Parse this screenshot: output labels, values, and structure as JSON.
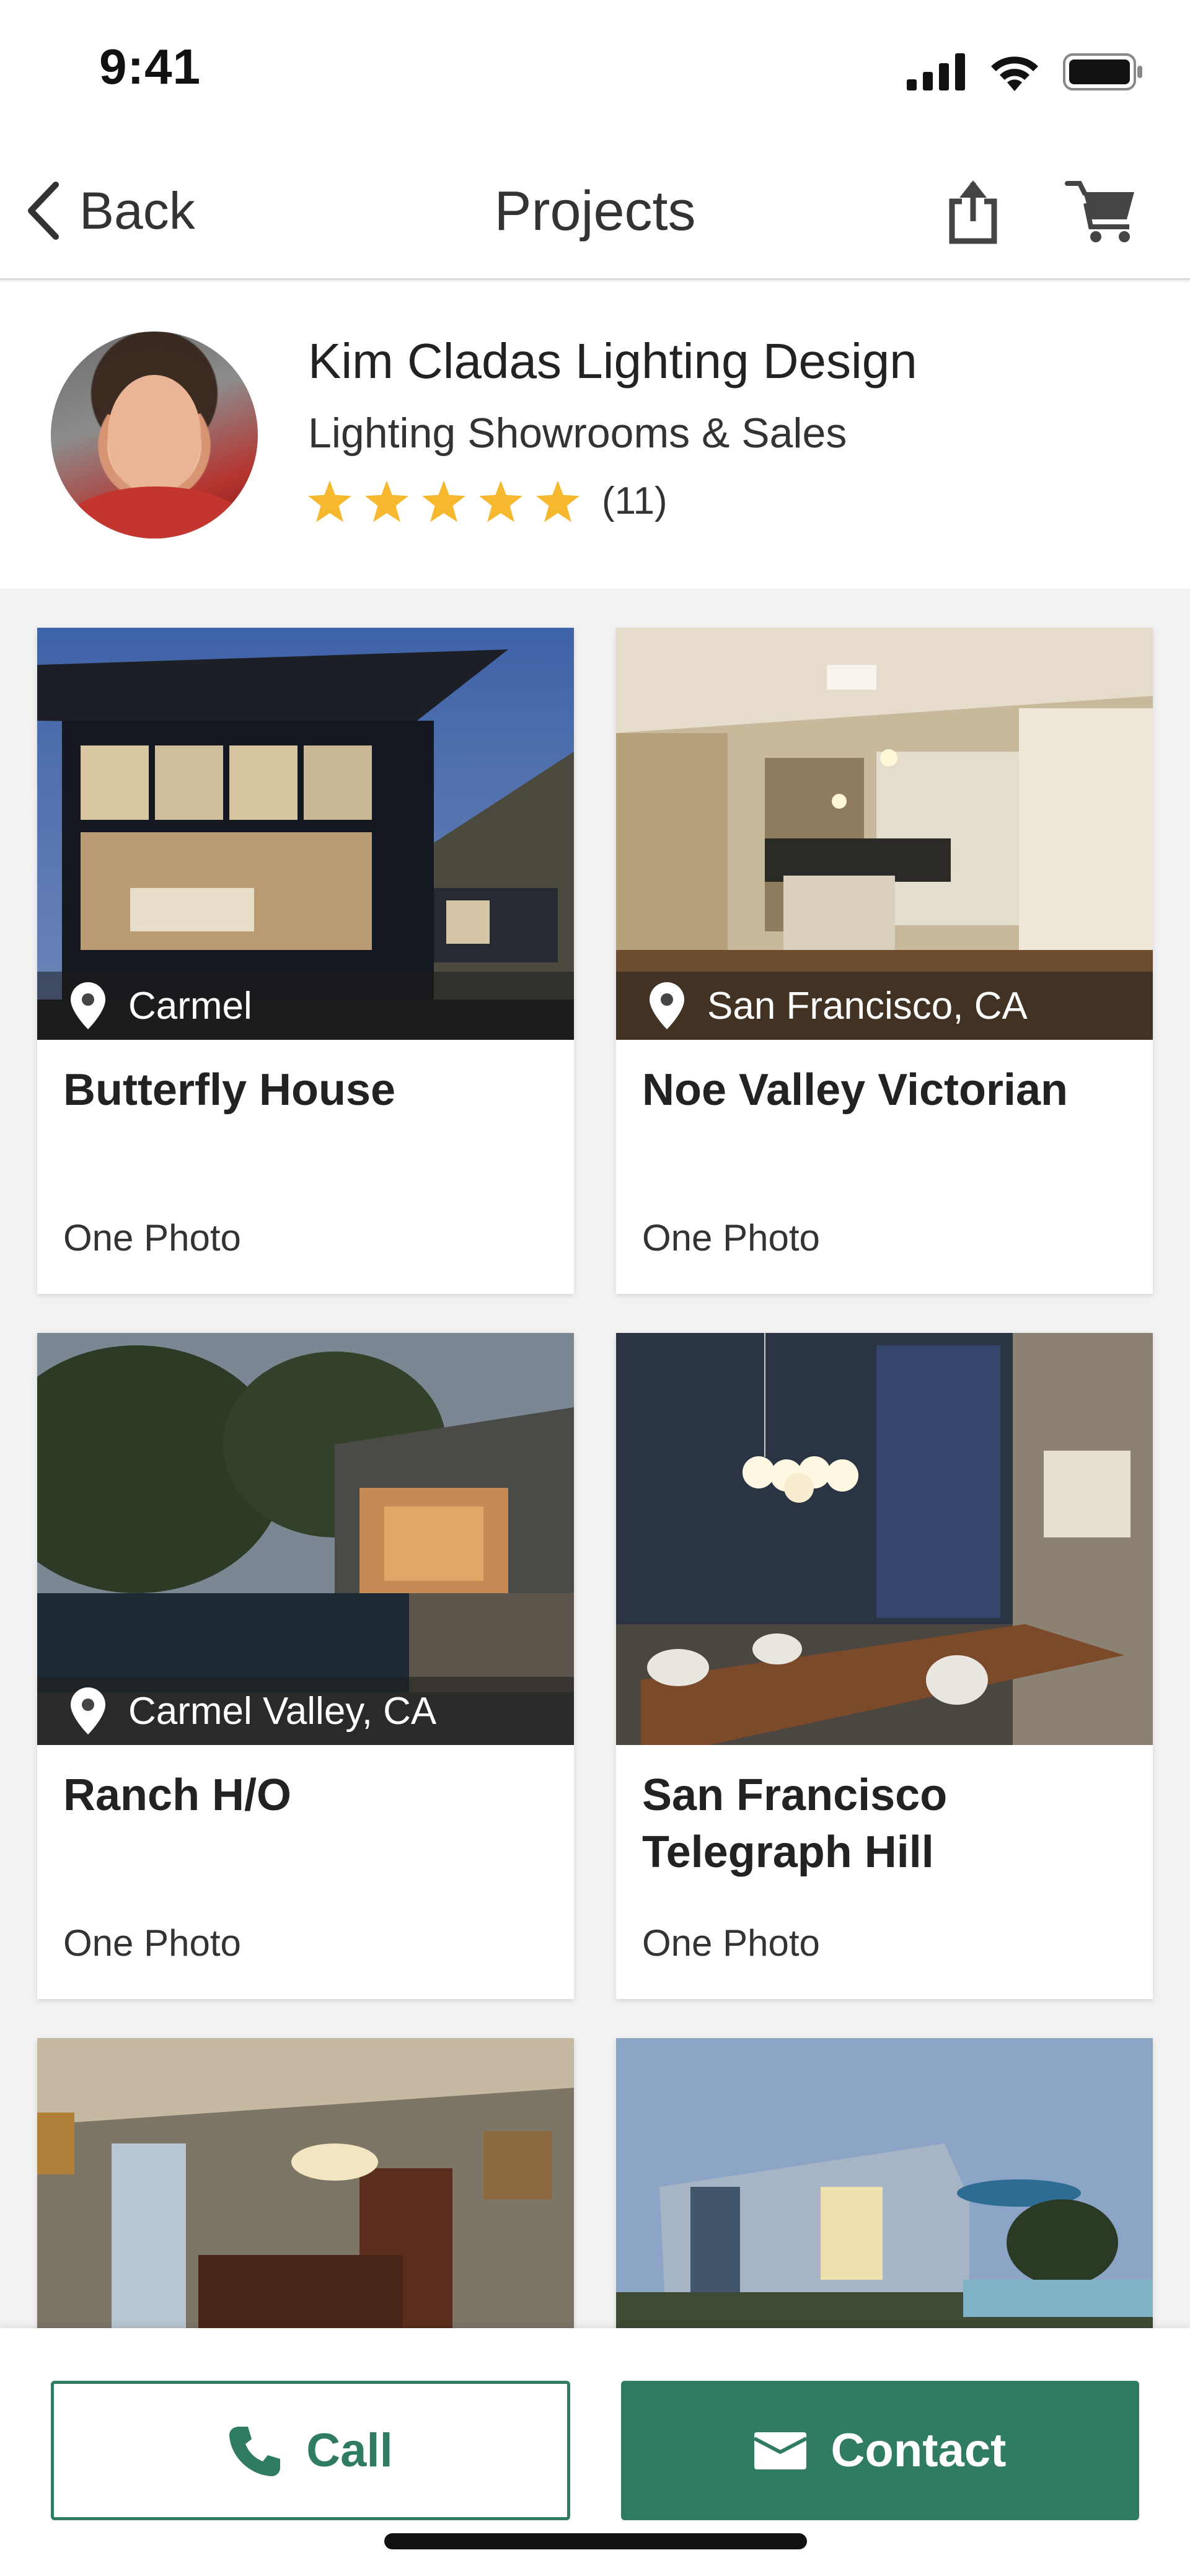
{
  "status": {
    "time": "9:41"
  },
  "nav": {
    "back_label": "Back",
    "title": "Projects"
  },
  "profile": {
    "name": "Kim Cladas Lighting Design",
    "category": "Lighting Showrooms & Sales",
    "rating": 5,
    "review_count": "(11)"
  },
  "projects": [
    {
      "location": "Carmel",
      "title": "Butterfly House",
      "photo_count": "One Photo"
    },
    {
      "location": "San Francisco, CA",
      "title": "Noe Valley Victorian",
      "photo_count": "One Photo"
    },
    {
      "location": "Carmel Valley, CA",
      "title": "Ranch H/O",
      "photo_count": "One Photo"
    },
    {
      "location": "",
      "title": "San Francisco Telegraph Hill",
      "photo_count": "One Photo"
    },
    {
      "location": "",
      "title": "",
      "photo_count": ""
    },
    {
      "location": "",
      "title": "",
      "photo_count": ""
    }
  ],
  "actions": {
    "call_label": "Call",
    "contact_label": "Contact"
  },
  "colors": {
    "brand": "#2f7b64",
    "star": "#f5b82e"
  }
}
